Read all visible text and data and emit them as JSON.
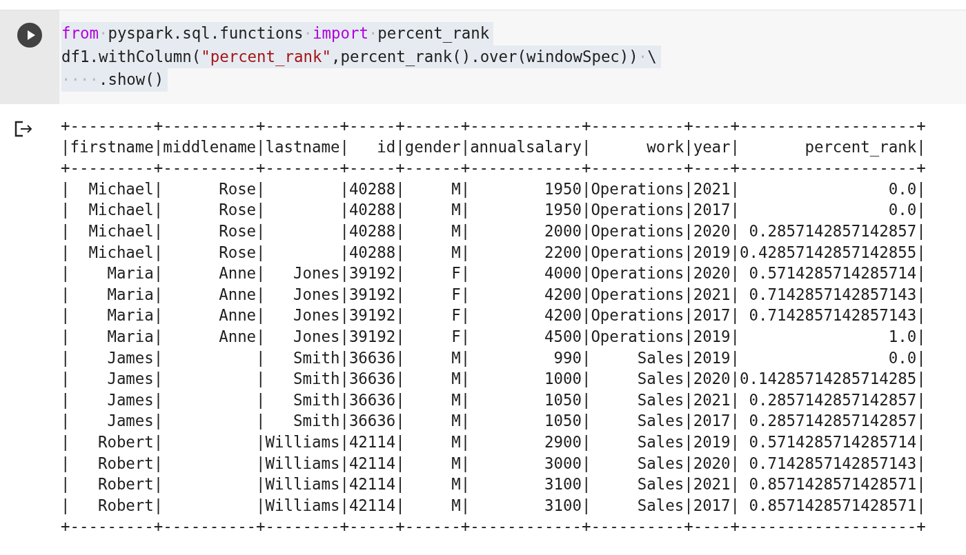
{
  "code_cell": {
    "lines": [
      [
        {
          "kind": "keyword",
          "text": "from"
        },
        {
          "kind": "space",
          "text": "·"
        },
        {
          "kind": "plain",
          "text": "pyspark.sql.functions"
        },
        {
          "kind": "space",
          "text": "·"
        },
        {
          "kind": "keyword",
          "text": "import"
        },
        {
          "kind": "space",
          "text": "·"
        },
        {
          "kind": "plain",
          "text": "percent_rank"
        }
      ],
      [
        {
          "kind": "plain",
          "text": "df1.withColumn("
        },
        {
          "kind": "string",
          "text": "\"percent_rank\""
        },
        {
          "kind": "plain",
          "text": ",percent_rank().over(windowSpec))"
        },
        {
          "kind": "space",
          "text": "·"
        },
        {
          "kind": "plain",
          "text": "\\"
        }
      ],
      [
        {
          "kind": "space",
          "text": "····"
        },
        {
          "kind": "plain",
          "text": ".show()"
        }
      ]
    ]
  },
  "output": {
    "lines": [
      "+---------+----------+--------+-----+------+------------+----------+----+-------------------+",
      "|firstname|middlename|lastname|   id|gender|annualsalary|      work|year|       percent_rank|",
      "+---------+----------+--------+-----+------+------------+----------+----+-------------------+",
      "|  Michael|      Rose|        |40288|     M|        1950|Operations|2021|                0.0|",
      "|  Michael|      Rose|        |40288|     M|        1950|Operations|2017|                0.0|",
      "|  Michael|      Rose|        |40288|     M|        2000|Operations|2020| 0.2857142857142857|",
      "|  Michael|      Rose|        |40288|     M|        2200|Operations|2019|0.42857142857142855|",
      "|    Maria|      Anne|   Jones|39192|     F|        4000|Operations|2020| 0.5714285714285714|",
      "|    Maria|      Anne|   Jones|39192|     F|        4200|Operations|2021| 0.7142857142857143|",
      "|    Maria|      Anne|   Jones|39192|     F|        4200|Operations|2017| 0.7142857142857143|",
      "|    Maria|      Anne|   Jones|39192|     F|        4500|Operations|2019|                1.0|",
      "|    James|          |   Smith|36636|     M|         990|     Sales|2019|                0.0|",
      "|    James|          |   Smith|36636|     M|        1000|     Sales|2020|0.14285714285714285|",
      "|    James|          |   Smith|36636|     M|        1050|     Sales|2021| 0.2857142857142857|",
      "|    James|          |   Smith|36636|     M|        1050|     Sales|2017| 0.2857142857142857|",
      "|   Robert|          |Williams|42114|     M|        2900|     Sales|2019| 0.5714285714285714|",
      "|   Robert|          |Williams|42114|     M|        3000|     Sales|2020| 0.7142857142857143|",
      "|   Robert|          |Williams|42114|     M|        3100|     Sales|2021| 0.8571428571428571|",
      "|   Robert|          |Williams|42114|     M|        3100|     Sales|2017| 0.8571428571428571|",
      "+---------+----------+--------+-----+------+------------+----------+----+-------------------+"
    ]
  }
}
